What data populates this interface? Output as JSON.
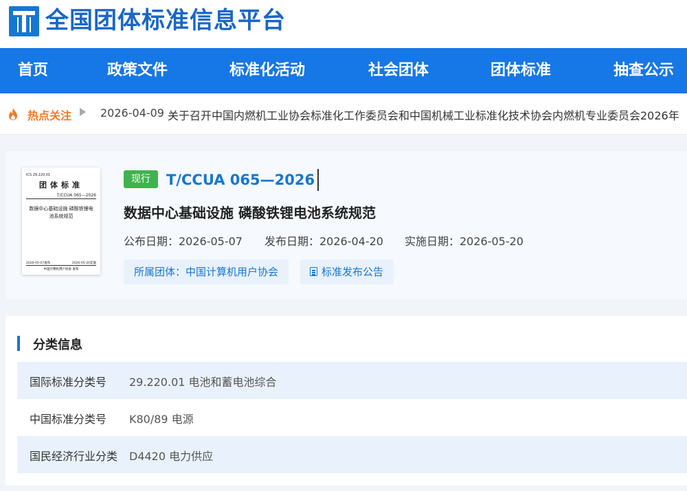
{
  "site": {
    "title": "全国团体标准信息平台"
  },
  "nav": [
    "首页",
    "政策文件",
    "标准化活动",
    "社会团体",
    "团体标准",
    "抽查公示"
  ],
  "hot": {
    "label": "热点关注",
    "date": "2026-04-09",
    "headline": "关于召开中国内燃机工业协会标准化工作委员会和中国机械工业标准化技术协会内燃机专业委员会2026年"
  },
  "standard": {
    "status": "现行",
    "code": "T/CCUA 065—2026",
    "title": "数据中心基础设施 磷酸铁锂电池系统规范",
    "published": "公布日期：2026-05-07",
    "issued": "发布日期：2026-04-20",
    "effective": "实施日期：2026-05-20",
    "org": "所属团体：中国计算机用户协会",
    "notice": "标准发布公告",
    "cover": {
      "ics": "ICS   29.220.01",
      "heading": "团体标准",
      "number": "T/CCUA 065—2026",
      "name_line1": "数据中心基础设施 磷酸铁锂电",
      "name_line2": "池系统规范",
      "pub": "2026-05-07发布",
      "impl": "2026-05-20实施",
      "org": "中国计算机用户协会 发布"
    }
  },
  "classification": {
    "title": "分类信息",
    "rows": [
      {
        "label": "国际标准分类号",
        "value": "29.220.01 电池和蓄电池综合"
      },
      {
        "label": "中国标准分类号",
        "value": "K80/89 电源"
      },
      {
        "label": "国民经济行业分类",
        "value": "D4420 电力供应"
      }
    ]
  }
}
